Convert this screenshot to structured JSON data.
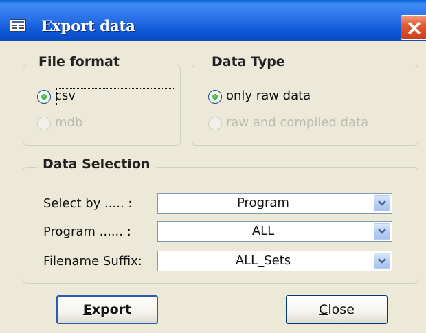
{
  "window": {
    "title": "Export data",
    "icon": "form-icon",
    "close_icon": "close-icon"
  },
  "file_format": {
    "title": "File format",
    "options": [
      {
        "label": "csv",
        "checked": true,
        "enabled": true
      },
      {
        "label": "mdb",
        "checked": false,
        "enabled": false
      }
    ]
  },
  "data_type": {
    "title": "Data Type",
    "options": [
      {
        "label": "only raw data",
        "checked": true,
        "enabled": true
      },
      {
        "label": "raw and compiled data",
        "checked": false,
        "enabled": false
      }
    ]
  },
  "data_selection": {
    "title": "Data Selection",
    "rows": [
      {
        "label": "Select by ..... :",
        "value": "Program"
      },
      {
        "label": "Program ...... :",
        "value": "ALL"
      },
      {
        "label": "Filename Suffix:",
        "value": "ALL_Sets"
      }
    ]
  },
  "buttons": {
    "export_first": "E",
    "export_rest": "xport",
    "close_first": "C",
    "close_rest": "lose"
  },
  "colors": {
    "titlebar": "#0b55d4",
    "face": "#ece9d8",
    "close": "#e35a33",
    "radio_check": "#229a2d"
  }
}
